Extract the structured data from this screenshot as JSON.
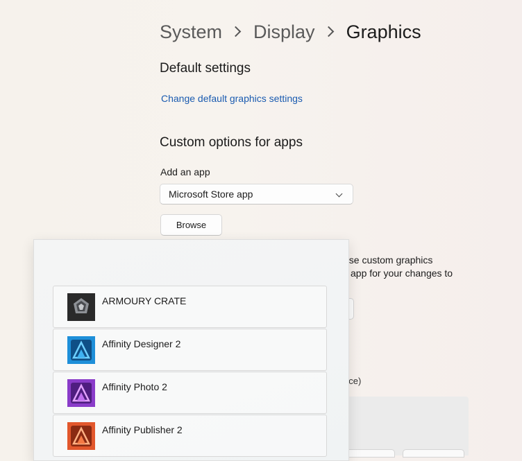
{
  "breadcrumb": {
    "items": [
      "System",
      "Display"
    ],
    "current": "Graphics"
  },
  "default_settings": {
    "title": "Default settings",
    "link": "Change default graphics settings"
  },
  "custom_options": {
    "title": "Custom options for apps",
    "add_app_label": "Add an app",
    "app_type_selected": "Microsoft Store app",
    "browse_label": "Browse"
  },
  "background_text": {
    "line1": "ose custom graphics",
    "line2": "app for your changes to",
    "line3": "nce)"
  },
  "app_picker": {
    "apps": [
      {
        "name": "ARMOURY CRATE",
        "icon": "armoury-crate-icon"
      },
      {
        "name": "Affinity Designer 2",
        "icon": "affinity-designer-icon"
      },
      {
        "name": "Affinity Photo 2",
        "icon": "affinity-photo-icon"
      },
      {
        "name": "Affinity Publisher 2",
        "icon": "affinity-publisher-icon"
      }
    ]
  },
  "colors": {
    "link": "#1a5bb0",
    "designer": "#1e8fd9",
    "photo": "#8a3cc9",
    "publisher": "#e2572c",
    "armoury": "#2a2a2a"
  }
}
